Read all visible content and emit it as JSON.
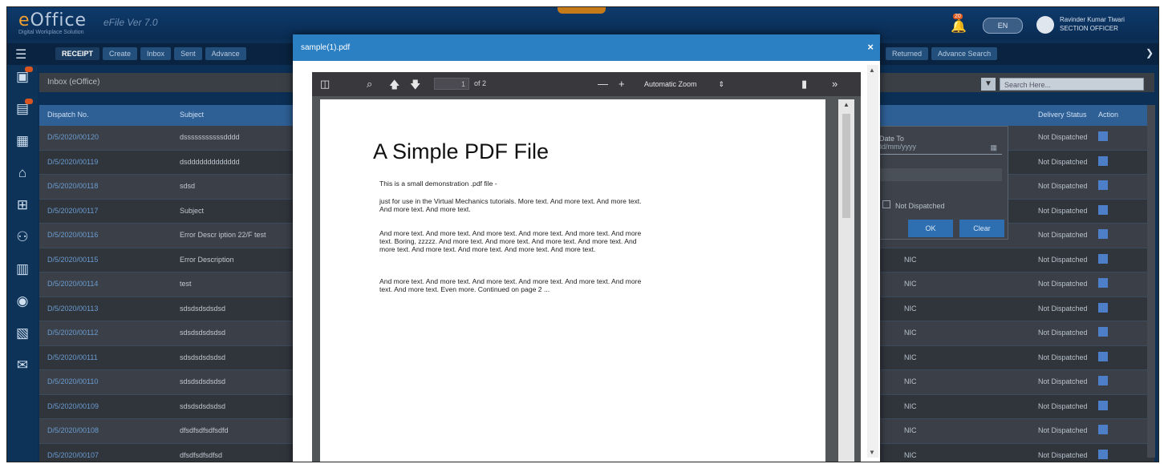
{
  "app": {
    "logo_prefix": "e",
    "logo_main": "Office",
    "logo_sub": "Digital Workplace Solution",
    "module": "eFile Ver 7.0",
    "user_pill": "EN",
    "user_name": "Ravinder Kumar Tiwari",
    "user_role": "SECTION OFFICER",
    "notification_count": "20"
  },
  "nav": {
    "tabs": [
      "RECEIPT",
      "Create",
      "Inbox",
      "Sent",
      "Advance"
    ],
    "right_tabs": [
      "Returned",
      "Advance Search"
    ]
  },
  "page": {
    "title": "Inbox (eOffice)",
    "search_placeholder": "Search Here..."
  },
  "table": {
    "headers": {
      "dispatch": "Dispatch No.",
      "subject": "Subject",
      "status": "Delivery Status",
      "action": "Action"
    },
    "rows": [
      {
        "dispatch": "D/5/2020/00120",
        "subject": "dsssssssssssdddd",
        "right": "",
        "status": "Not Dispatched"
      },
      {
        "dispatch": "D/5/2020/00119",
        "subject": "dsddddddddddddd",
        "right": "",
        "status": "Not Dispatched"
      },
      {
        "dispatch": "D/5/2020/00118",
        "subject": "sdsd",
        "right": "",
        "status": "Not Dispatched"
      },
      {
        "dispatch": "D/5/2020/00117",
        "subject": "Subject",
        "right": "",
        "status": "Not Dispatched"
      },
      {
        "dispatch": "D/5/2020/00116",
        "subject": "Error Descr iption 22/F test",
        "right": "",
        "status": "Not Dispatched"
      },
      {
        "dispatch": "D/5/2020/00115",
        "subject": "Error Description",
        "right": "NIC",
        "status": "Not Dispatched"
      },
      {
        "dispatch": "D/5/2020/00114",
        "subject": "test",
        "right": "NIC",
        "status": "Not Dispatched"
      },
      {
        "dispatch": "D/5/2020/00113",
        "subject": "sdsdsdsdsdsd",
        "right": "NIC",
        "status": "Not Dispatched"
      },
      {
        "dispatch": "D/5/2020/00112",
        "subject": "sdsdsdsdsdsd",
        "right": "NIC",
        "status": "Not Dispatched"
      },
      {
        "dispatch": "D/5/2020/00111",
        "subject": "sdsdsdsdsdsd",
        "right": "NIC",
        "status": "Not Dispatched"
      },
      {
        "dispatch": "D/5/2020/00110",
        "subject": "sdsdsdsdsdsd",
        "right": "NIC",
        "status": "Not Dispatched"
      },
      {
        "dispatch": "D/5/2020/00109",
        "subject": "sdsdsdsdsdsd",
        "right": "NIC",
        "status": "Not Dispatched"
      },
      {
        "dispatch": "D/5/2020/00108",
        "subject": "dfsdfsdfsdfsdfd",
        "right": "NIC",
        "status": "Not Dispatched"
      },
      {
        "dispatch": "D/5/2020/00107",
        "subject": "dfsdfsdfsdfsd",
        "right": "NIC",
        "status": "Not Dispatched"
      }
    ]
  },
  "filter_panel": {
    "label": "Date To",
    "select_placeholder": "dd/mm/yyyy",
    "checkbox_label": "Not Dispatched",
    "ok": "OK",
    "clear": "Clear"
  },
  "modal": {
    "title": "sample(1).pdf",
    "close": "×"
  },
  "viewer": {
    "page_current": "1",
    "page_total": "of 2",
    "zoom": "Automatic Zoom"
  },
  "document": {
    "title": "A Simple PDF File",
    "p1": "This is a small demonstration .pdf file -",
    "p2": "just for use in the Virtual Mechanics tutorials. More text. And more text. And more text. And more text. And more text.",
    "p3": "And more text. And more text. And more text. And more text. And more text. And more text. Boring, zzzzz. And more text. And more text. And more text. And more text. And more text. And more text. And more text. And more text. And more text.",
    "p4": "And more text. And more text. And more text. And more text. And more text. And more text. And more text. Even more. Continued on page 2 ..."
  },
  "colors": {
    "modal_header": "#2b7fc3",
    "app_header": "#0e3a6b",
    "table_header": "#2e5f95",
    "accent": "#f0a030"
  }
}
